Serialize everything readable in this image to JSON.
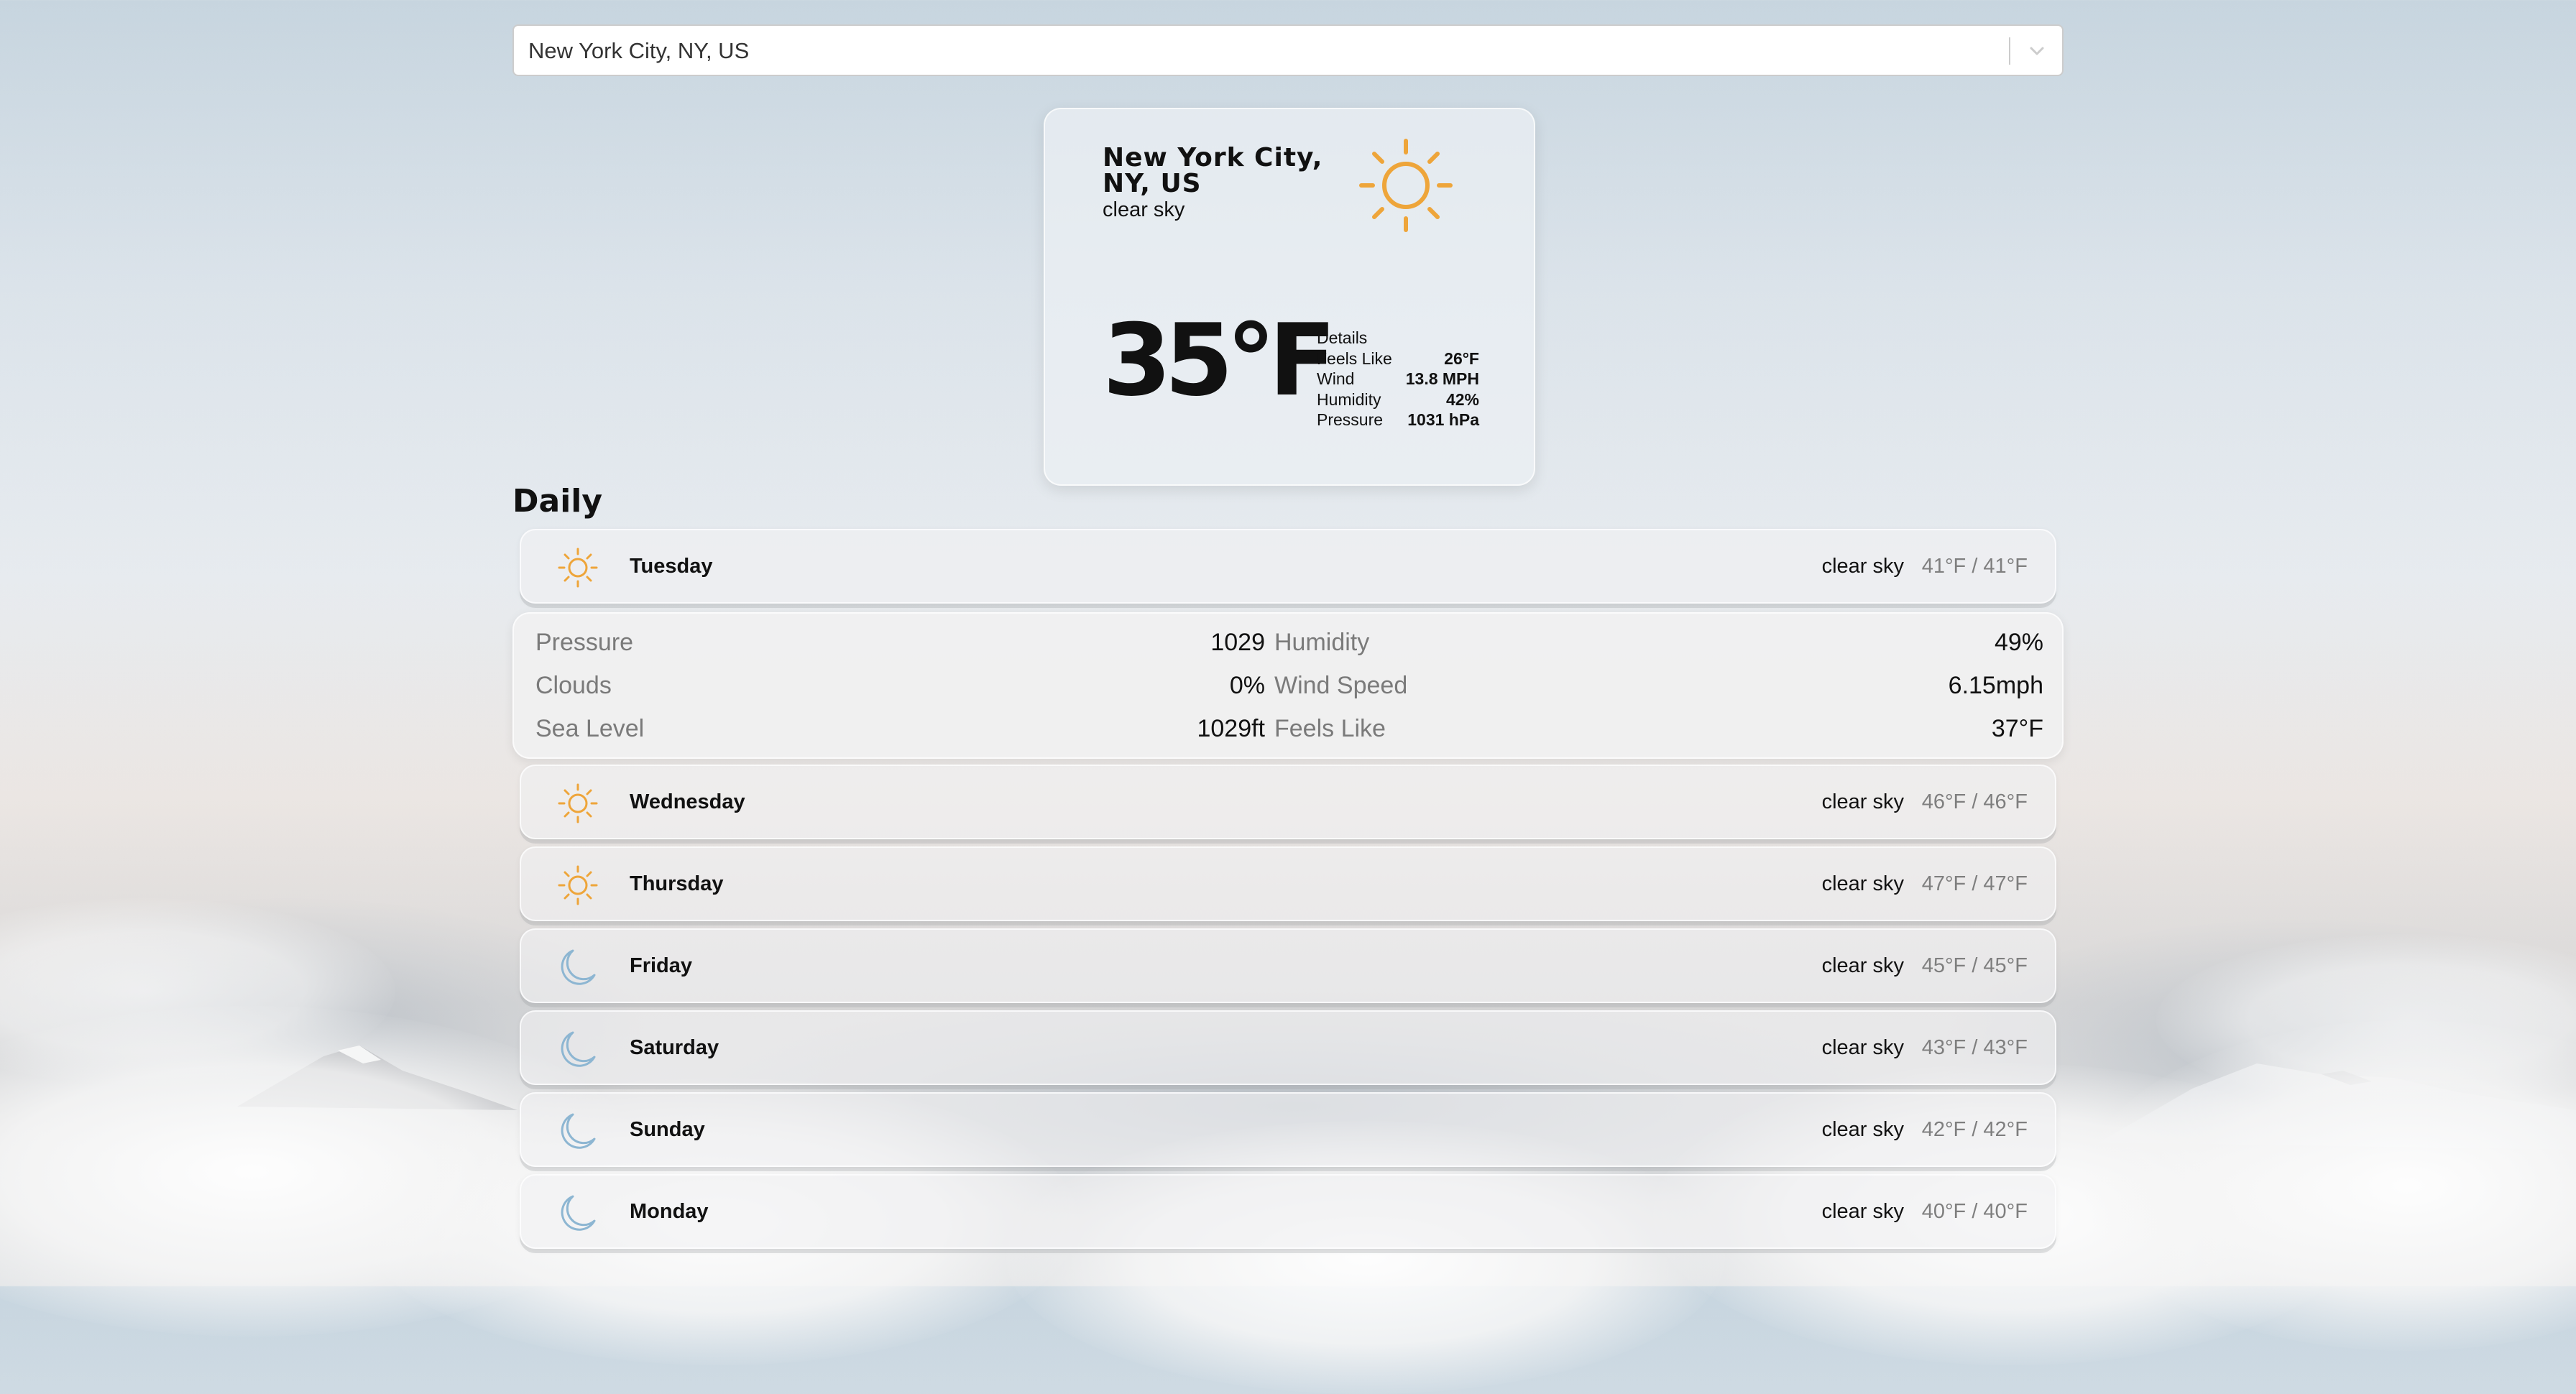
{
  "search": {
    "value": "New York City, NY, US"
  },
  "current": {
    "city": "New York City, NY, US",
    "description": "clear sky",
    "temperature": "35°F",
    "icon": "sun-icon",
    "details_title": "Details",
    "details": [
      {
        "label": "Feels Like",
        "value": "26°F"
      },
      {
        "label": "Wind",
        "value": "13.8 MPH"
      },
      {
        "label": "Humidity",
        "value": "42%"
      },
      {
        "label": "Pressure",
        "value": "1031 hPa"
      }
    ]
  },
  "daily": {
    "title": "Daily",
    "days": [
      {
        "name": "Tuesday",
        "description": "clear sky",
        "range": "41°F / 41°F",
        "icon": "sun-icon",
        "expanded": true
      },
      {
        "name": "Wednesday",
        "description": "clear sky",
        "range": "46°F / 46°F",
        "icon": "sun-icon"
      },
      {
        "name": "Thursday",
        "description": "clear sky",
        "range": "47°F / 47°F",
        "icon": "sun-icon"
      },
      {
        "name": "Friday",
        "description": "clear sky",
        "range": "45°F / 45°F",
        "icon": "moon-icon"
      },
      {
        "name": "Saturday",
        "description": "clear sky",
        "range": "43°F / 43°F",
        "icon": "moon-icon"
      },
      {
        "name": "Sunday",
        "description": "clear sky",
        "range": "42°F / 42°F",
        "icon": "moon-icon"
      },
      {
        "name": "Monday",
        "description": "clear sky",
        "range": "40°F / 40°F",
        "icon": "moon-icon"
      }
    ],
    "expanded_details": [
      {
        "label": "Pressure",
        "value": "1029"
      },
      {
        "label": "Humidity",
        "value": "49%"
      },
      {
        "label": "Clouds",
        "value": "0%"
      },
      {
        "label": "Wind Speed",
        "value": "6.15mph"
      },
      {
        "label": "Sea Level",
        "value": "1029ft"
      },
      {
        "label": "Feels Like",
        "value": "37°F"
      }
    ]
  },
  "colors": {
    "sun": "#eea53a",
    "moon": "#8db6d2",
    "muted_text": "#7f7f7f"
  }
}
